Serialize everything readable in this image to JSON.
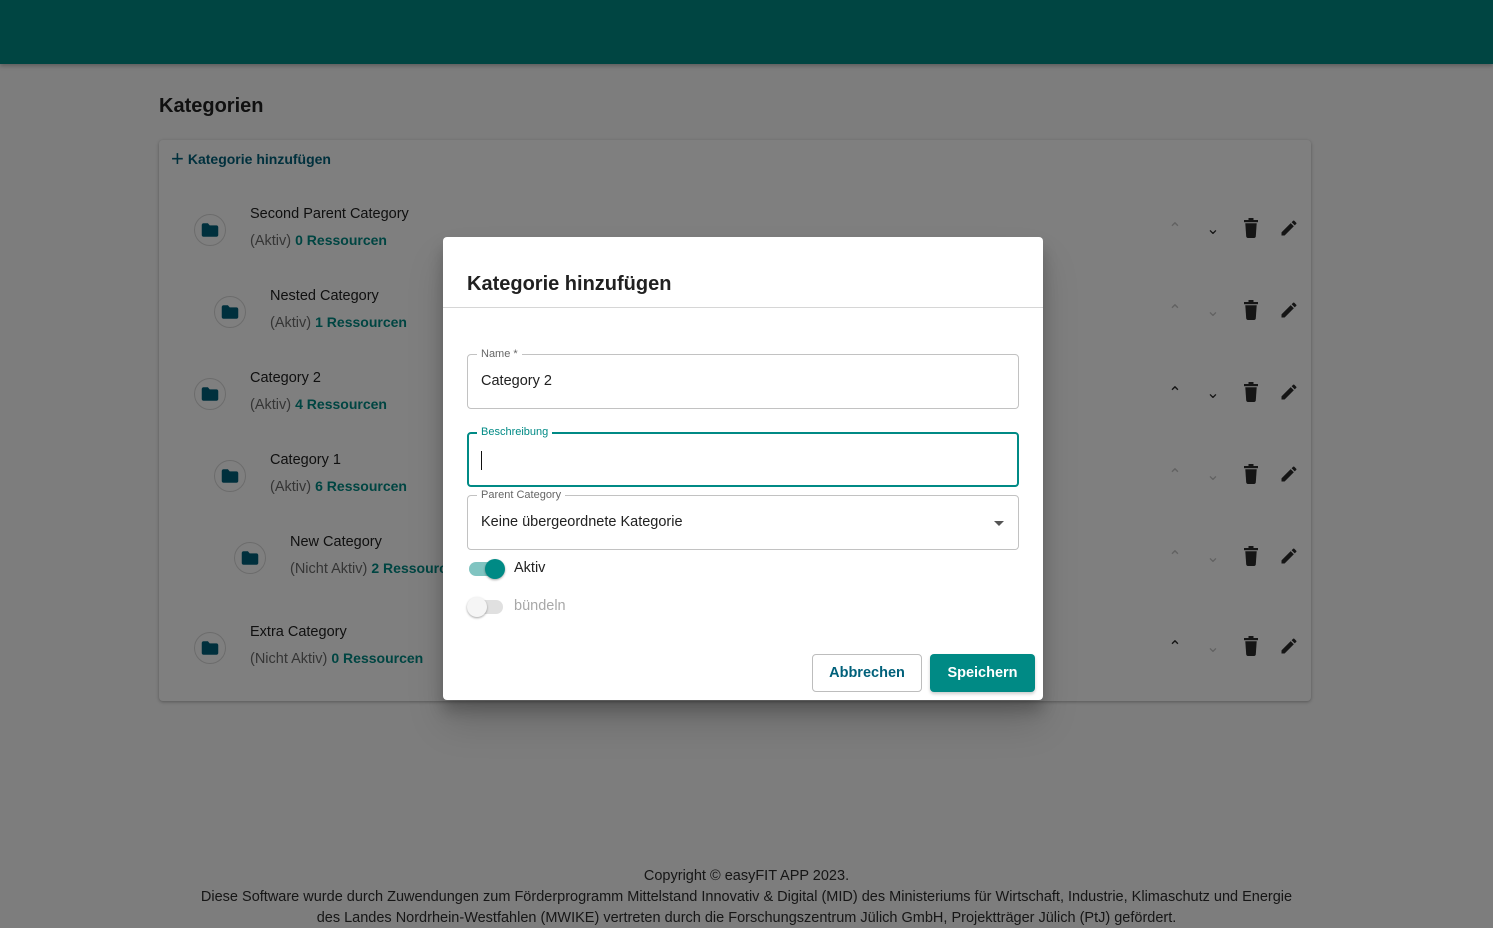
{
  "colors": {
    "brand": "#008a85",
    "link_dark": "#00607a",
    "row_icon": "#00607a",
    "action_icon": "#2b2b2b"
  },
  "page": {
    "title": "Kategorien",
    "add_label": "Kategorie hinzufügen"
  },
  "categories": [
    {
      "name": "Second Parent Category",
      "status": "(Aktiv)",
      "resources": "0 Ressourcen",
      "level": 0,
      "up_enabled": false,
      "down_enabled": true
    },
    {
      "name": "Nested Category",
      "status": "(Aktiv)",
      "resources": "1 Ressourcen",
      "level": 1,
      "up_enabled": false,
      "down_enabled": false
    },
    {
      "name": "Category 2",
      "status": "(Aktiv)",
      "resources": "4 Ressourcen",
      "level": 0,
      "up_enabled": true,
      "down_enabled": true
    },
    {
      "name": "Category 1",
      "status": "(Aktiv)",
      "resources": "6 Ressourcen",
      "level": 1,
      "up_enabled": false,
      "down_enabled": false
    },
    {
      "name": "New Category",
      "status": "(Nicht Aktiv)",
      "resources": "2 Ressourcen",
      "level": 2,
      "up_enabled": false,
      "down_enabled": false
    },
    {
      "name": "Extra Category",
      "status": "(Nicht Aktiv)",
      "resources": "0 Ressourcen",
      "level": 0,
      "up_enabled": true,
      "down_enabled": false
    }
  ],
  "dialog": {
    "title": "Kategorie hinzufügen",
    "name_label": "Name *",
    "name_value": "Category 2",
    "description_label": "Beschreibung",
    "description_value": "",
    "parent_label": "Parent Category",
    "parent_value": "Keine übergeordnete Kategorie",
    "aktiv_label": "Aktiv",
    "aktiv_checked": true,
    "buendeln_label": "bündeln",
    "buendeln_checked": false,
    "cancel_label": "Abbrechen",
    "save_label": "Speichern"
  },
  "footer": {
    "line1": "Copyright © easyFIT APP 2023.",
    "line2": "Diese Software wurde durch Zuwendungen zum Förderprogramm Mittelstand Innovativ & Digital (MID) des Ministeriums für Wirtschaft, Industrie, Klimaschutz und Energie",
    "line3": "des Landes Nordrhein-Westfahlen (MWIKE) vertreten durch die Forschungszentrum Jülich GmbH, Projektträger Jülich (PtJ) gefördert."
  }
}
